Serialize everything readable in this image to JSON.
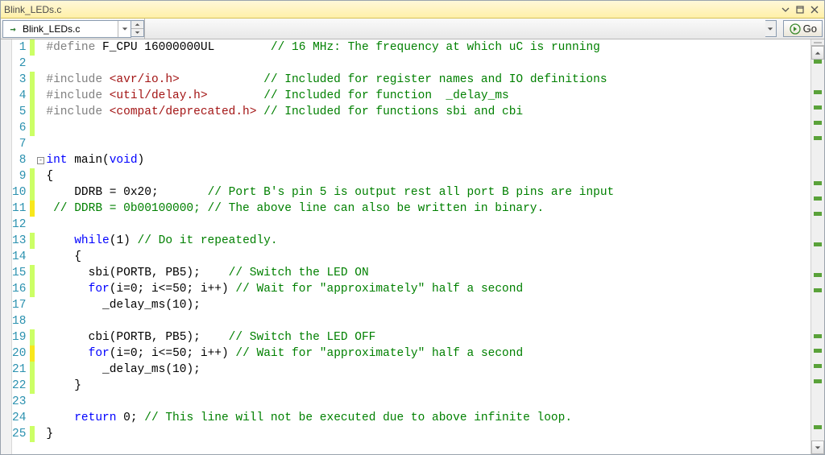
{
  "window": {
    "title": "Blink_LEDs.c"
  },
  "toolbar": {
    "file_combo": {
      "icon_glyph": "→",
      "text": "Blink_LEDs.c"
    },
    "go_button": {
      "label": "Go"
    }
  },
  "editor": {
    "lines": [
      {
        "n": 1,
        "change": "mod",
        "fold": "",
        "tokens": [
          [
            "pp",
            "#define"
          ],
          [
            "pl",
            " F_CPU "
          ],
          [
            "num",
            "16000000UL"
          ],
          [
            "pl",
            "        "
          ],
          [
            "cmt",
            "// 16 MHz: The frequency at which uC is running"
          ]
        ]
      },
      {
        "n": 2,
        "change": "",
        "fold": "",
        "tokens": []
      },
      {
        "n": 3,
        "change": "mod",
        "fold": "",
        "tokens": [
          [
            "pp",
            "#include"
          ],
          [
            "pl",
            " "
          ],
          [
            "str",
            "<avr/io.h>"
          ],
          [
            "pl",
            "            "
          ],
          [
            "cmt",
            "// Included for register names and IO definitions"
          ]
        ]
      },
      {
        "n": 4,
        "change": "mod",
        "fold": "",
        "tokens": [
          [
            "pp",
            "#include"
          ],
          [
            "pl",
            " "
          ],
          [
            "str",
            "<util/delay.h>"
          ],
          [
            "pl",
            "        "
          ],
          [
            "cmt",
            "// Included for function  _delay_ms"
          ]
        ]
      },
      {
        "n": 5,
        "change": "mod",
        "fold": "",
        "tokens": [
          [
            "pp",
            "#include"
          ],
          [
            "pl",
            " "
          ],
          [
            "str",
            "<compat/deprecated.h>"
          ],
          [
            "pl",
            " "
          ],
          [
            "cmt",
            "// Included for functions sbi and cbi"
          ]
        ]
      },
      {
        "n": 6,
        "change": "mod",
        "fold": "",
        "tokens": []
      },
      {
        "n": 7,
        "change": "",
        "fold": "",
        "tokens": []
      },
      {
        "n": 8,
        "change": "",
        "fold": "minus",
        "tokens": [
          [
            "kw",
            "int"
          ],
          [
            "pl",
            " main("
          ],
          [
            "kw",
            "void"
          ],
          [
            "pl",
            ")"
          ]
        ]
      },
      {
        "n": 9,
        "change": "mod",
        "fold": "",
        "tokens": [
          [
            "pl",
            "{"
          ]
        ]
      },
      {
        "n": 10,
        "change": "mod",
        "fold": "",
        "tokens": [
          [
            "pl",
            "    DDRB = "
          ],
          [
            "num",
            "0x20"
          ],
          [
            "pl",
            ";       "
          ],
          [
            "cmt",
            "// Port B's pin 5 is output rest all port B pins are input"
          ]
        ]
      },
      {
        "n": 11,
        "change": "sav",
        "fold": "",
        "tokens": [
          [
            "pl",
            " "
          ],
          [
            "cmt",
            "// DDRB = 0b00100000; // The above line can also be written in binary."
          ]
        ]
      },
      {
        "n": 12,
        "change": "",
        "fold": "",
        "tokens": []
      },
      {
        "n": 13,
        "change": "mod",
        "fold": "",
        "tokens": [
          [
            "pl",
            "    "
          ],
          [
            "kw",
            "while"
          ],
          [
            "pl",
            "("
          ],
          [
            "num",
            "1"
          ],
          [
            "pl",
            ") "
          ],
          [
            "cmt",
            "// Do it repeatedly."
          ]
        ]
      },
      {
        "n": 14,
        "change": "",
        "fold": "",
        "tokens": [
          [
            "pl",
            "    {"
          ]
        ]
      },
      {
        "n": 15,
        "change": "mod",
        "fold": "",
        "tokens": [
          [
            "pl",
            "      sbi(PORTB, PB5);    "
          ],
          [
            "cmt",
            "// Switch the LED ON"
          ]
        ]
      },
      {
        "n": 16,
        "change": "mod",
        "fold": "",
        "tokens": [
          [
            "pl",
            "      "
          ],
          [
            "kw",
            "for"
          ],
          [
            "pl",
            "(i="
          ],
          [
            "num",
            "0"
          ],
          [
            "pl",
            "; i<="
          ],
          [
            "num",
            "50"
          ],
          [
            "pl",
            "; i++) "
          ],
          [
            "cmt",
            "// Wait for \"approximately\" half a second"
          ]
        ]
      },
      {
        "n": 17,
        "change": "",
        "fold": "",
        "tokens": [
          [
            "pl",
            "        _delay_ms("
          ],
          [
            "num",
            "10"
          ],
          [
            "pl",
            ");"
          ]
        ]
      },
      {
        "n": 18,
        "change": "",
        "fold": "",
        "tokens": []
      },
      {
        "n": 19,
        "change": "mod",
        "fold": "",
        "tokens": [
          [
            "pl",
            "      cbi(PORTB, PB5);    "
          ],
          [
            "cmt",
            "// Switch the LED OFF"
          ]
        ]
      },
      {
        "n": 20,
        "change": "sav",
        "fold": "",
        "tokens": [
          [
            "pl",
            "      "
          ],
          [
            "kw",
            "for"
          ],
          [
            "pl",
            "(i="
          ],
          [
            "num",
            "0"
          ],
          [
            "pl",
            "; i<="
          ],
          [
            "num",
            "50"
          ],
          [
            "pl",
            "; i++) "
          ],
          [
            "cmt",
            "// Wait for \"approximately\" half a second"
          ]
        ]
      },
      {
        "n": 21,
        "change": "mod",
        "fold": "",
        "tokens": [
          [
            "pl",
            "        _delay_ms("
          ],
          [
            "num",
            "10"
          ],
          [
            "pl",
            ");"
          ]
        ]
      },
      {
        "n": 22,
        "change": "mod",
        "fold": "",
        "tokens": [
          [
            "pl",
            "    }"
          ]
        ]
      },
      {
        "n": 23,
        "change": "",
        "fold": "",
        "tokens": []
      },
      {
        "n": 24,
        "change": "",
        "fold": "",
        "tokens": [
          [
            "pl",
            "    "
          ],
          [
            "kw",
            "return"
          ],
          [
            "pl",
            " "
          ],
          [
            "num",
            "0"
          ],
          [
            "pl",
            "; "
          ],
          [
            "cmt",
            "// This line will not be executed due to above infinite loop."
          ]
        ]
      },
      {
        "n": 25,
        "change": "mod",
        "fold": "",
        "tokens": [
          [
            "pl",
            "}"
          ]
        ]
      }
    ]
  }
}
